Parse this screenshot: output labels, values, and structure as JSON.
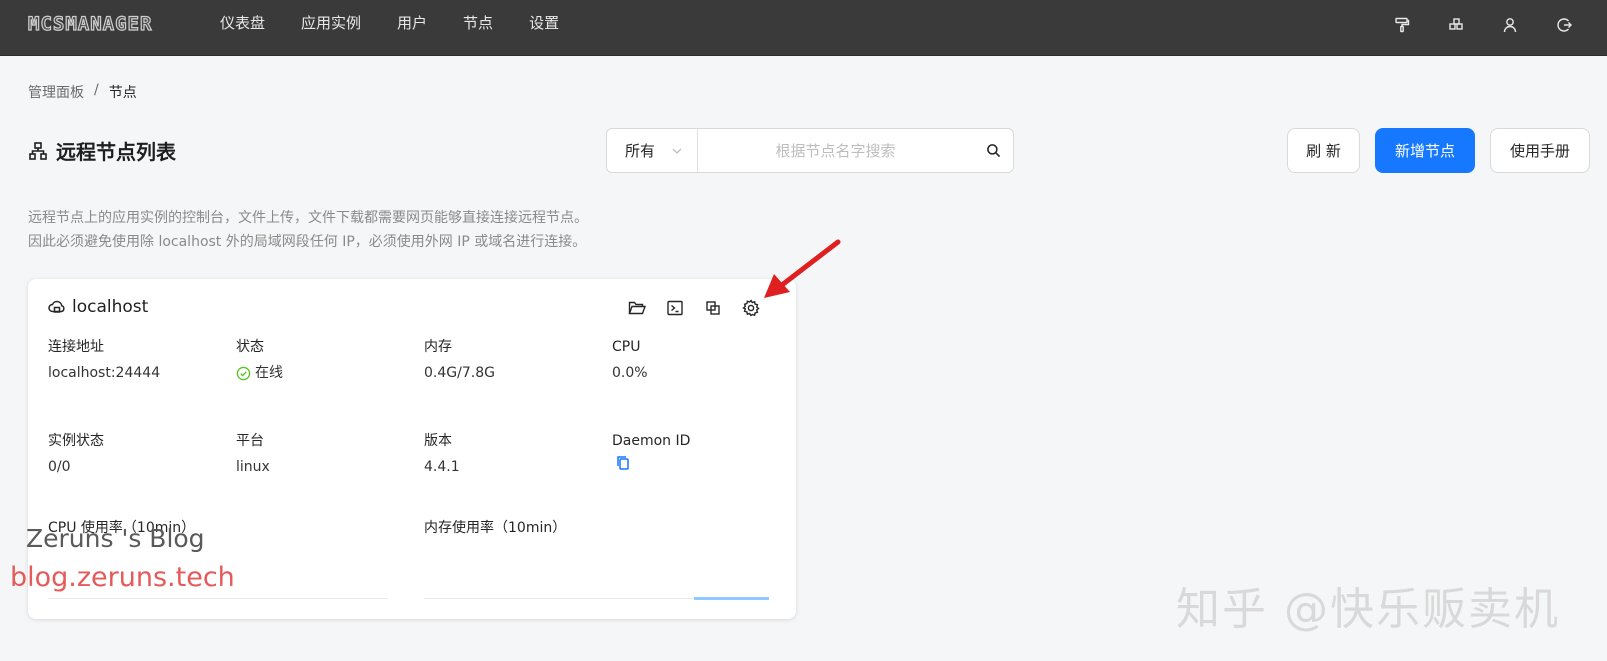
{
  "topbar": {
    "logo": "MCSMANAGER",
    "nav": [
      "仪表盘",
      "应用实例",
      "用户",
      "节点",
      "设置"
    ],
    "icons": [
      "paint-roller-icon",
      "layout-icon",
      "user-icon",
      "logout-icon"
    ]
  },
  "breadcrumb": {
    "root": "管理面板",
    "separator": "/",
    "current": "节点"
  },
  "page": {
    "title": "远程节点列表",
    "filter_value": "所有",
    "search_placeholder": "根据节点名字搜索",
    "refresh": "刷 新",
    "add_node": "新增节点",
    "manual": "使用手册"
  },
  "notice": {
    "line1": "远程节点上的应用实例的控制台，文件上传，文件下载都需要网页能够直接连接远程节点。",
    "line2": "因此必须避免使用除 localhost 外的局域网段任何 IP，必须使用外网 IP 或域名进行连接。"
  },
  "node": {
    "name": "localhost",
    "fields": {
      "address_label": "连接地址",
      "address": "localhost:24444",
      "status_label": "状态",
      "status": "在线",
      "memory_label": "内存",
      "memory": "0.4G/7.8G",
      "cpu_label": "CPU",
      "cpu": "0.0%",
      "instances_label": "实例状态",
      "instances": "0/0",
      "platform_label": "平台",
      "platform": "linux",
      "version_label": "版本",
      "version": "4.4.1",
      "daemon_label": "Daemon ID"
    },
    "cpu_chart_title": "CPU 使用率（10min）",
    "mem_chart_title": "内存使用率（10min）"
  },
  "watermarks": {
    "blog_name": "Zeruns 's Blog",
    "blog_url": "blog.zeruns.tech",
    "zhihu": "知乎 @快乐贩卖机"
  },
  "colors": {
    "primary": "#1677ff",
    "online": "#52c41a",
    "topbar": "#3a3a3a",
    "arrow": "#e02020"
  }
}
